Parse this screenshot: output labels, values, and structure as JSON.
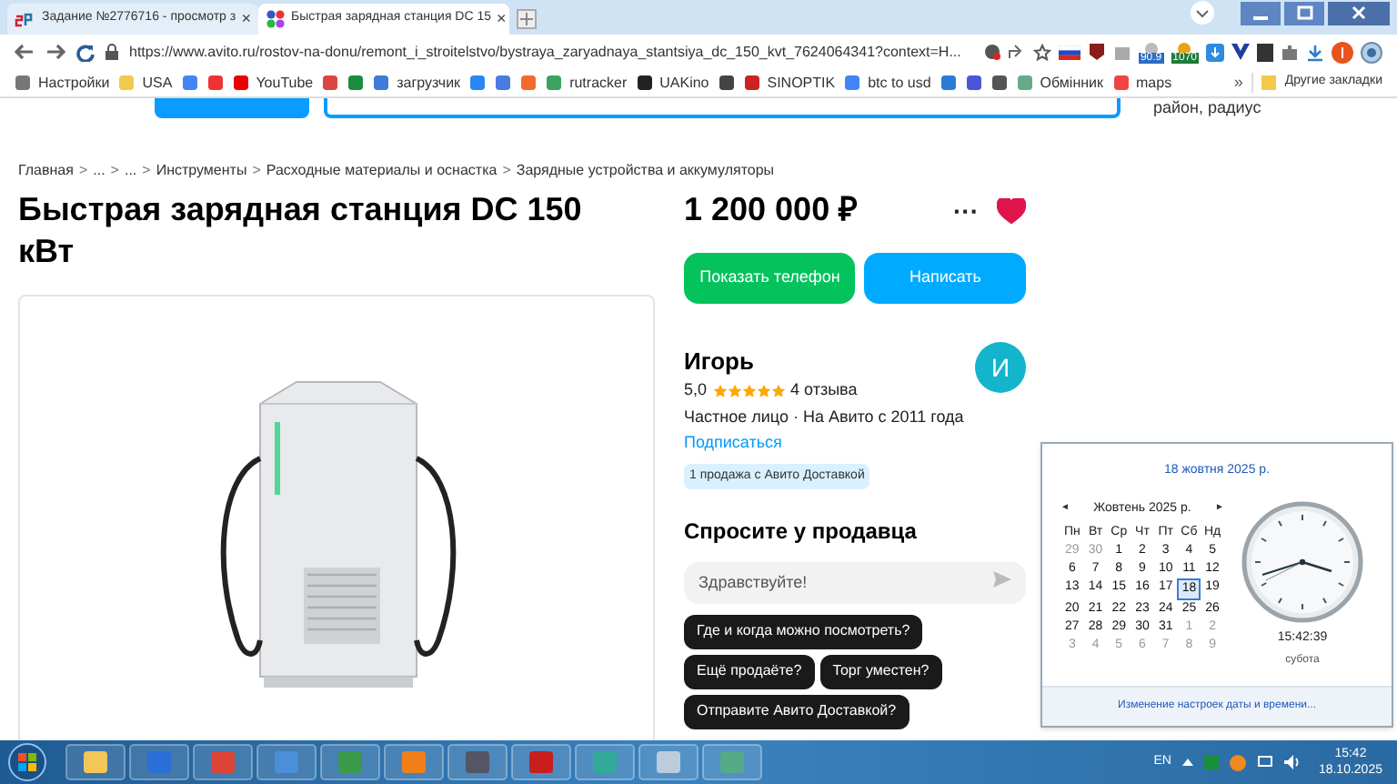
{
  "browser": {
    "tabs": [
      {
        "title": "Задание №2776716 - просмотр з",
        "selected": false,
        "close": "×"
      },
      {
        "title": "Быстрая зарядная станция DC 15",
        "selected": true,
        "close": "×"
      }
    ],
    "url": "https://www.avito.ru/rostov-na-donu/remont_i_stroitelstvo/bystraya_zaryadnaya_stantsiya_dc_150_kvt_7624064341?context=H...",
    "extension_badges": [
      "90.9",
      "1070"
    ],
    "bookmarks": [
      {
        "kind": "text",
        "label": "Настройки"
      },
      {
        "kind": "text",
        "label": "USA"
      },
      {
        "kind": "icon"
      },
      {
        "kind": "icon"
      },
      {
        "kind": "text",
        "label": "YouTube"
      },
      {
        "kind": "icon"
      },
      {
        "kind": "icon"
      },
      {
        "kind": "text",
        "label": "загрузчик"
      },
      {
        "kind": "icon"
      },
      {
        "kind": "icon"
      },
      {
        "kind": "icon"
      },
      {
        "kind": "text",
        "label": "rutracker"
      },
      {
        "kind": "text",
        "label": "UAKino"
      },
      {
        "kind": "icon"
      },
      {
        "kind": "text",
        "label": "SINOPTIK"
      },
      {
        "kind": "text",
        "label": "btc to usd"
      },
      {
        "kind": "icon"
      },
      {
        "kind": "icon"
      },
      {
        "kind": "icon"
      },
      {
        "kind": "text",
        "label": "Обмінник"
      },
      {
        "kind": "text",
        "label": "maps"
      }
    ],
    "more": "»",
    "other_bookmarks": "Другие закладки"
  },
  "page": {
    "header_hint": "район, радиус",
    "breadcrumbs": [
      "Главная",
      "...",
      "...",
      "Инструменты",
      "Расходные материалы и оснастка",
      "Зарядные устройства и аккумуляторы"
    ],
    "breadcrumb_separator": ">",
    "title": "Быстрая зарядная станция DC 150 кВт",
    "price": "1 200 000 ₽",
    "more": "···",
    "favorite": true,
    "buttons": [
      "Показать телефон",
      "Написать"
    ],
    "seller": {
      "name": "Игорь",
      "rating": "5,0",
      "stars": 5,
      "reviews": "4 отзыва",
      "info": "Частное лицо · На Авито с 2011 года",
      "subscribe": "Подписаться",
      "badge": "1 продажа с Авито Доставкой",
      "avatar": "И"
    },
    "ask": {
      "title": "Спросите у продавца",
      "placeholder": "Здравствуйте!",
      "suggestions": [
        "Где и когда можно посмотреть?",
        "Ещё продаёте?",
        "Торг уместен?",
        "Отправите Авито Доставкой?"
      ]
    }
  },
  "calendar": {
    "date_title": "18 жовтня 2025 р.",
    "prev": "◄",
    "next": "►",
    "month": "Жовтень 2025 р.",
    "weekdays": [
      "Пн",
      "Вт",
      "Ср",
      "Чт",
      "Пт",
      "Сб",
      "Нд"
    ],
    "weeks": [
      [
        {
          "day": "29",
          "muted": true,
          "selected": false
        },
        {
          "day": "30",
          "muted": true,
          "selected": false
        },
        {
          "day": "1",
          "muted": false,
          "selected": false
        },
        {
          "day": "2",
          "muted": false,
          "selected": false
        },
        {
          "day": "3",
          "muted": false,
          "selected": false
        },
        {
          "day": "4",
          "muted": false,
          "selected": false
        },
        {
          "day": "5",
          "muted": false,
          "selected": false
        }
      ],
      [
        {
          "day": "6",
          "muted": false,
          "selected": false
        },
        {
          "day": "7",
          "muted": false,
          "selected": false
        },
        {
          "day": "8",
          "muted": false,
          "selected": false
        },
        {
          "day": "9",
          "muted": false,
          "selected": false
        },
        {
          "day": "10",
          "muted": false,
          "selected": false
        },
        {
          "day": "11",
          "muted": false,
          "selected": false
        },
        {
          "day": "12",
          "muted": false,
          "selected": false
        }
      ],
      [
        {
          "day": "13",
          "muted": false,
          "selected": false
        },
        {
          "day": "14",
          "muted": false,
          "selected": false
        },
        {
          "day": "15",
          "muted": false,
          "selected": false
        },
        {
          "day": "16",
          "muted": false,
          "selected": false
        },
        {
          "day": "17",
          "muted": false,
          "selected": false
        },
        {
          "day": "18",
          "muted": false,
          "selected": true
        },
        {
          "day": "19",
          "muted": false,
          "selected": false
        }
      ],
      [
        {
          "day": "20",
          "muted": false,
          "selected": false
        },
        {
          "day": "21",
          "muted": false,
          "selected": false
        },
        {
          "day": "22",
          "muted": false,
          "selected": false
        },
        {
          "day": "23",
          "muted": false,
          "selected": false
        },
        {
          "day": "24",
          "muted": false,
          "selected": false
        },
        {
          "day": "25",
          "muted": false,
          "selected": false
        },
        {
          "day": "26",
          "muted": false,
          "selected": false
        }
      ],
      [
        {
          "day": "27",
          "muted": false,
          "selected": false
        },
        {
          "day": "28",
          "muted": false,
          "selected": false
        },
        {
          "day": "29",
          "muted": false,
          "selected": false
        },
        {
          "day": "30",
          "muted": false,
          "selected": false
        },
        {
          "day": "31",
          "muted": false,
          "selected": false
        },
        {
          "day": "1",
          "muted": true,
          "selected": false
        },
        {
          "day": "2",
          "muted": true,
          "selected": false
        }
      ],
      [
        {
          "day": "3",
          "muted": true,
          "selected": false
        },
        {
          "day": "4",
          "muted": true,
          "selected": false
        },
        {
          "day": "5",
          "muted": true,
          "selected": false
        },
        {
          "day": "6",
          "muted": true,
          "selected": false
        },
        {
          "day": "7",
          "muted": true,
          "selected": false
        },
        {
          "day": "8",
          "muted": true,
          "selected": false
        },
        {
          "day": "9",
          "muted": true,
          "selected": false
        }
      ]
    ],
    "time": "15:42:39",
    "weekday": "субота",
    "settings_link": "Изменение настроек даты и времени..."
  },
  "taskbar": {
    "language": "EN",
    "time": "15:42",
    "date": "18.10.2025"
  }
}
